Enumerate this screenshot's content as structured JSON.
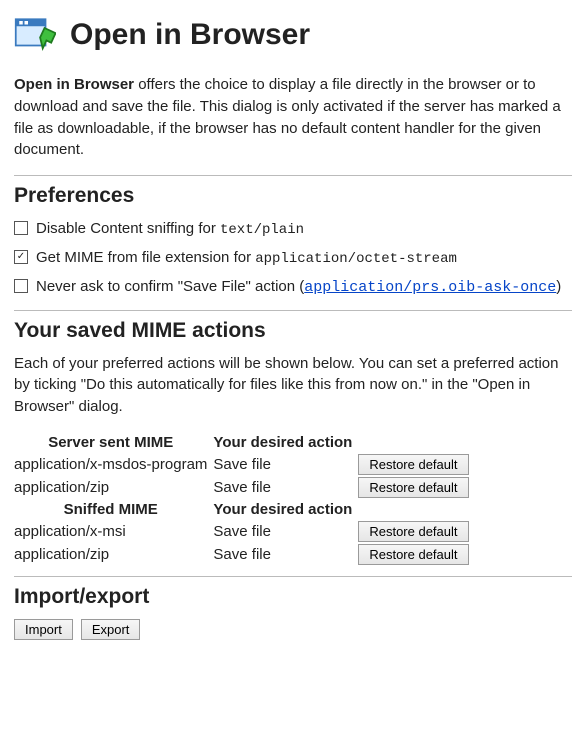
{
  "header": {
    "title": "Open in Browser"
  },
  "intro": {
    "bold_lead": "Open in Browser",
    "rest": " offers the choice to display a file directly in the browser or to download and save the file. This dialog is only activated if the server has marked a file as downloadable, if the browser has no default content handler for the given document."
  },
  "sections": {
    "preferences_heading": "Preferences",
    "mime_actions_heading": "Your saved MIME actions",
    "import_export_heading": "Import/export"
  },
  "prefs": {
    "disable_sniffing": {
      "checked": false,
      "label_pre": "Disable Content sniffing for ",
      "code": "text/plain"
    },
    "get_mime_ext": {
      "checked": true,
      "label_pre": "Get MIME from file extension for ",
      "code": "application/octet-stream"
    },
    "never_ask": {
      "checked": false,
      "label_pre": "Never ask to confirm \"Save File\" action (",
      "link_text": "application/prs.oib-ask-once",
      "label_post": ")"
    }
  },
  "mime_actions": {
    "intro": "Each of your preferred actions will be shown below. You can set a preferred action by ticking \"Do this automatically for files like this from now on.\" in the \"Open in Browser\" dialog.",
    "server_table": {
      "col1": "Server sent MIME",
      "col2": "Your desired action",
      "rows": [
        {
          "mime": "application/x-msdos-program",
          "action": "Save file",
          "button": "Restore default"
        },
        {
          "mime": "application/zip",
          "action": "Save file",
          "button": "Restore default"
        }
      ]
    },
    "sniffed_table": {
      "col1": "Sniffed MIME",
      "col2": "Your desired action",
      "rows": [
        {
          "mime": "application/x-msi",
          "action": "Save file",
          "button": "Restore default"
        },
        {
          "mime": "application/zip",
          "action": "Save file",
          "button": "Restore default"
        }
      ]
    }
  },
  "import_export": {
    "import_label": "Import",
    "export_label": "Export"
  }
}
